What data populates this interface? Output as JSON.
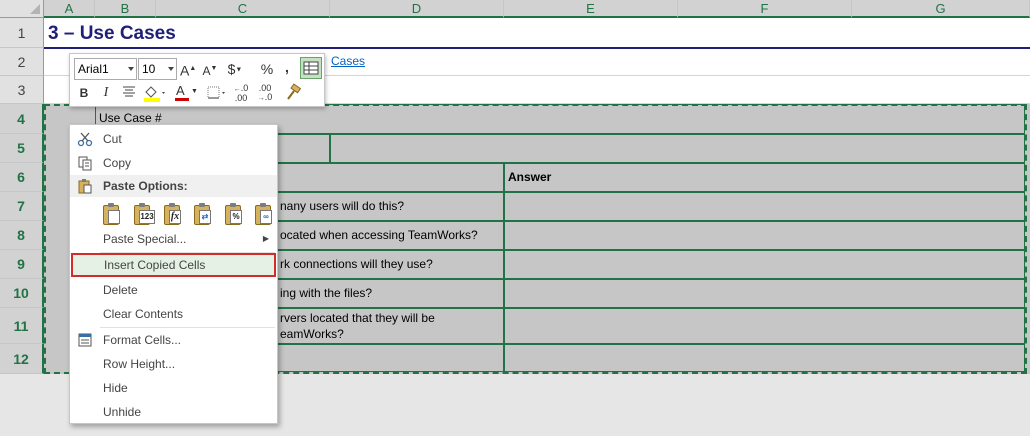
{
  "columns": [
    "A",
    "B",
    "C",
    "D",
    "E",
    "F",
    "G"
  ],
  "rows": [
    "1",
    "2",
    "3",
    "4",
    "5",
    "6",
    "7",
    "8",
    "9",
    "10",
    "11",
    "12"
  ],
  "sheet": {
    "title": "3 – Use Cases",
    "link_text": "Cases",
    "use_case_label": "Use Case #",
    "answer_header": "Answer",
    "questions": [
      "nany users will do this?",
      "ocated when accessing TeamWorks?",
      "rk connections will they use?",
      "ing with the files?",
      "rvers located that they will be",
      "eamWorks?"
    ]
  },
  "mini_toolbar": {
    "font_name": "Arial1",
    "font_size": "10",
    "bold": "B",
    "italic": "I",
    "currency": "$",
    "percent": "%",
    "comma": ",",
    "increase_font": "A",
    "decrease_font": "A",
    "font_color_letter": "A",
    "decimal_increase": ".0",
    "decimal_decrease": ".00"
  },
  "context_menu": {
    "cut": "Cut",
    "copy": "Copy",
    "paste_options": "Paste Options:",
    "paste_special": "Paste Special...",
    "insert_copied_cells": "Insert Copied Cells",
    "delete": "Delete",
    "clear_contents": "Clear Contents",
    "format_cells": "Format Cells...",
    "row_height": "Row Height...",
    "hide": "Hide",
    "unhide": "Unhide",
    "paste_icon_values": "123",
    "paste_icon_formula": "fx",
    "paste_icon_percent": "%"
  },
  "colors": {
    "accent_green": "#217346",
    "highlight_red": "#d42b2b",
    "title_navy": "#1f1f7a",
    "link_blue": "#0563c1"
  }
}
